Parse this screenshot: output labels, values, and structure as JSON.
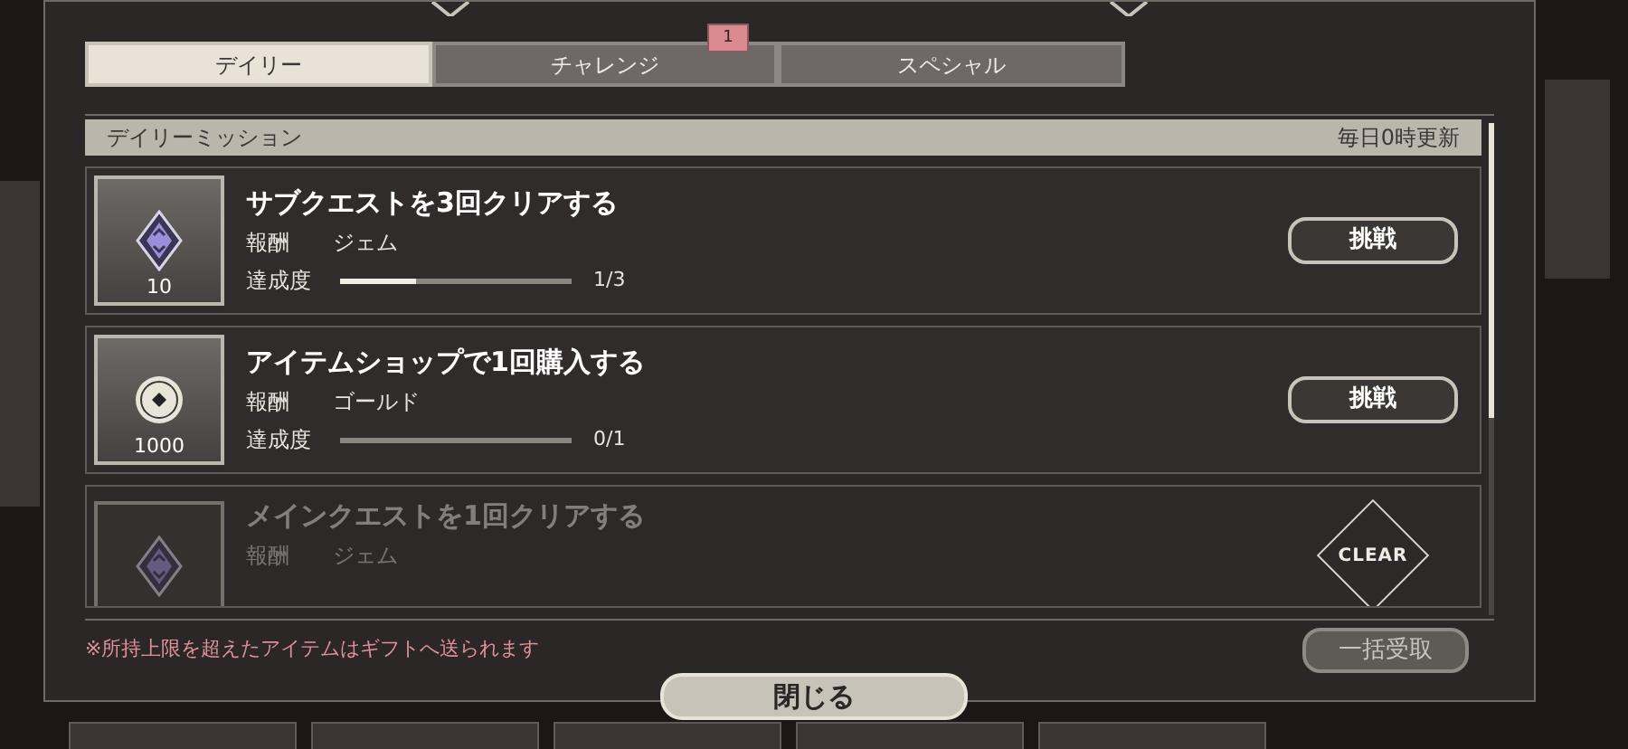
{
  "tabs": [
    {
      "label": "デイリー",
      "selected": true
    },
    {
      "label": "チャレンジ",
      "selected": false,
      "badge": "1"
    },
    {
      "label": "スペシャル",
      "selected": false
    }
  ],
  "section": {
    "title": "デイリーミッション",
    "note": "毎日0時更新"
  },
  "missions": [
    {
      "title": "サブクエストを3回クリアする",
      "reward_label": "報酬",
      "reward": "ジェム",
      "kind": "gem",
      "quantity": "10",
      "progress_label": "達成度",
      "level": 0.33,
      "progress": "1/3",
      "cleared": false,
      "action": "挑戦"
    },
    {
      "title": "アイテムショップで1回購入する",
      "reward_label": "報酬",
      "reward": "ゴールド",
      "kind": "coin",
      "quantity": "1000",
      "progress_label": "達成度",
      "level": 0,
      "progress": "0/1",
      "cleared": false,
      "action": "挑戦"
    },
    {
      "title": "メインクエストを1回クリアする",
      "reward_label": "報酬",
      "reward": "ジェム",
      "kind": "gem",
      "cleared": true,
      "stamp": "CLEAR"
    }
  ],
  "footer_note": "※所持上限を超えたアイテムはギフトへ送られます",
  "bulk_button": {
    "label": "一括受取",
    "disabled": true
  },
  "close_button": "閉じる"
}
